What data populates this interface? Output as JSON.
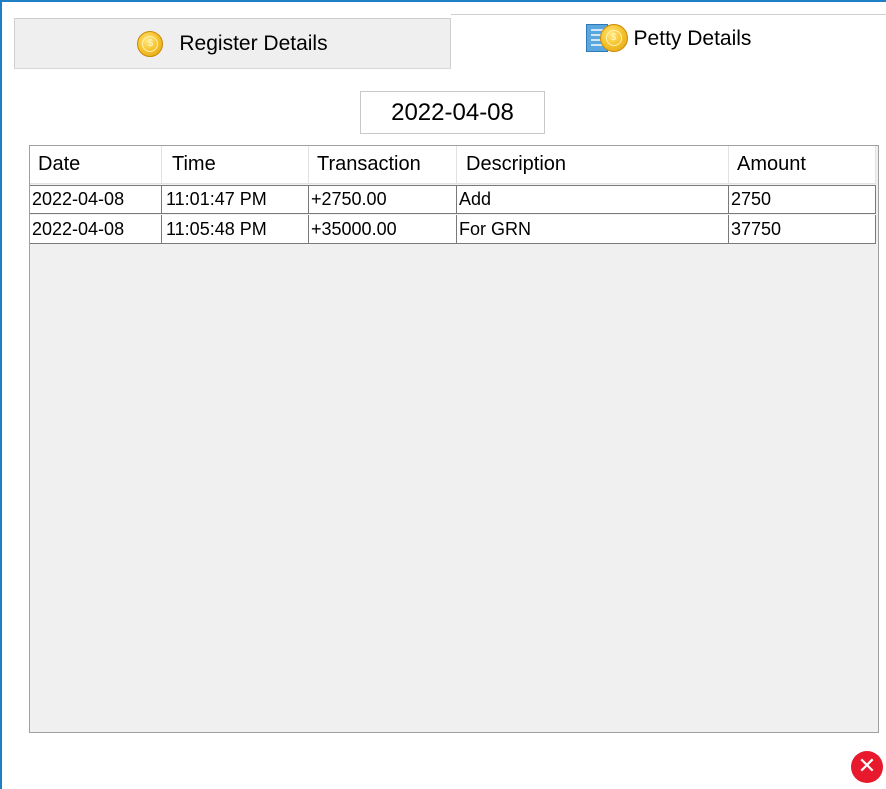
{
  "tabs": [
    {
      "label": "Register Details",
      "icon": "coin-icon",
      "active": false
    },
    {
      "label": "Petty Details",
      "icon": "ledger-coin-icon",
      "active": true
    }
  ],
  "date_filter": {
    "value": "2022-04-08"
  },
  "table": {
    "columns": [
      "Date",
      "Time",
      "Transaction",
      "Description",
      "Amount"
    ],
    "rows": [
      [
        "2022-04-08",
        "11:01:47 PM",
        "+2750.00",
        "Add",
        "2750"
      ],
      [
        "2022-04-08",
        "11:05:48 PM",
        "+35000.00",
        "For GRN",
        "37750"
      ]
    ]
  },
  "close_button": {
    "icon": "close-icon",
    "color": "#e8192c"
  },
  "colors": {
    "accent_border": "#1e7fc4",
    "grid_background": "#f0f0f0"
  }
}
